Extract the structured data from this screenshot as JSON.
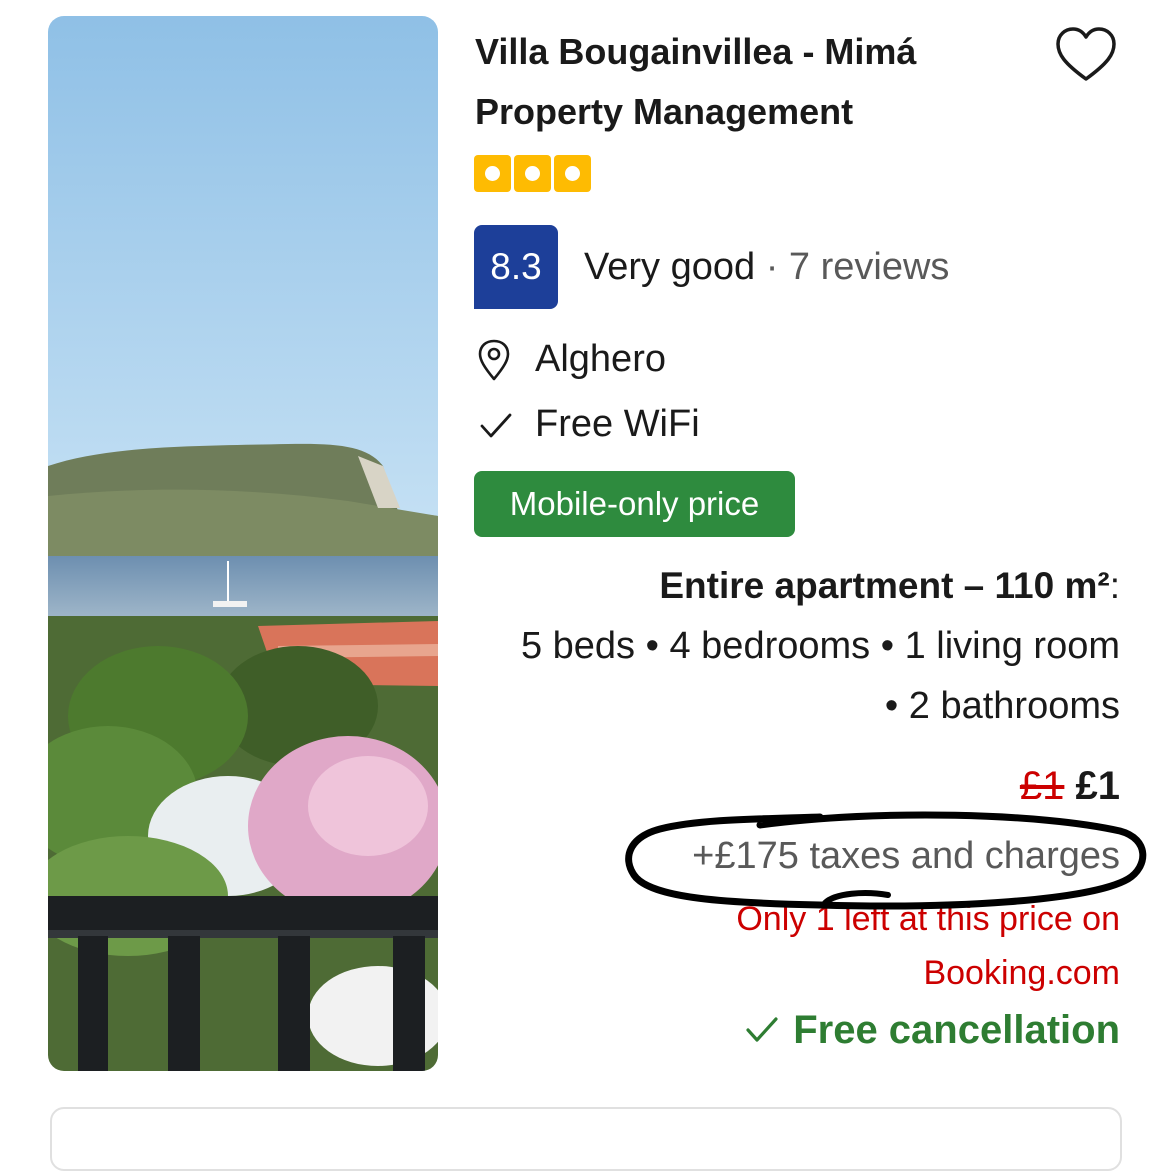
{
  "property": {
    "title": "Villa Bougainvillea - Mimá Property Management",
    "star_count": 3,
    "star_color": "#febb02",
    "score": "8.3",
    "score_color": "#1d3f99",
    "rating_word": "Very good",
    "reviews": " · 7 reviews",
    "location": "Alghero",
    "amenity": "Free WiFi",
    "badge": "Mobile-only price",
    "badge_color": "#2e8b3e",
    "room_type": "Entire apartment – 110 m²",
    "room_type_suffix": ":",
    "room_detail": "5 beds • 4 bedrooms • 1 living room • 2 bathrooms",
    "old_price": "£1",
    "new_price": "£1",
    "taxes": "+£175 taxes and charges",
    "availability_line1": "Only 1 left at this price on",
    "availability_line2": "Booking.com",
    "cancellation": "Free cancellation",
    "cancellation_color": "#2e7d32",
    "icons": [
      "heart-icon",
      "map-pin-icon",
      "checkmark-icon"
    ]
  }
}
